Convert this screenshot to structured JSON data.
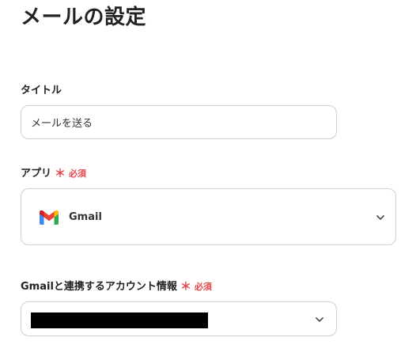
{
  "page": {
    "title": "メールの設定"
  },
  "title_field": {
    "label": "タイトル",
    "value": "メールを送る"
  },
  "app_field": {
    "label": "アプリ",
    "required_mark": "＊",
    "required_text": "必須",
    "selected_app": "Gmail",
    "icon": "gmail-icon"
  },
  "account_field": {
    "label": "Gmailと連携するアカウント情報",
    "required_mark": "＊",
    "required_text": "必須"
  },
  "colors": {
    "required": "#e5484d",
    "border": "#cfcfd6",
    "text": "#222222"
  }
}
